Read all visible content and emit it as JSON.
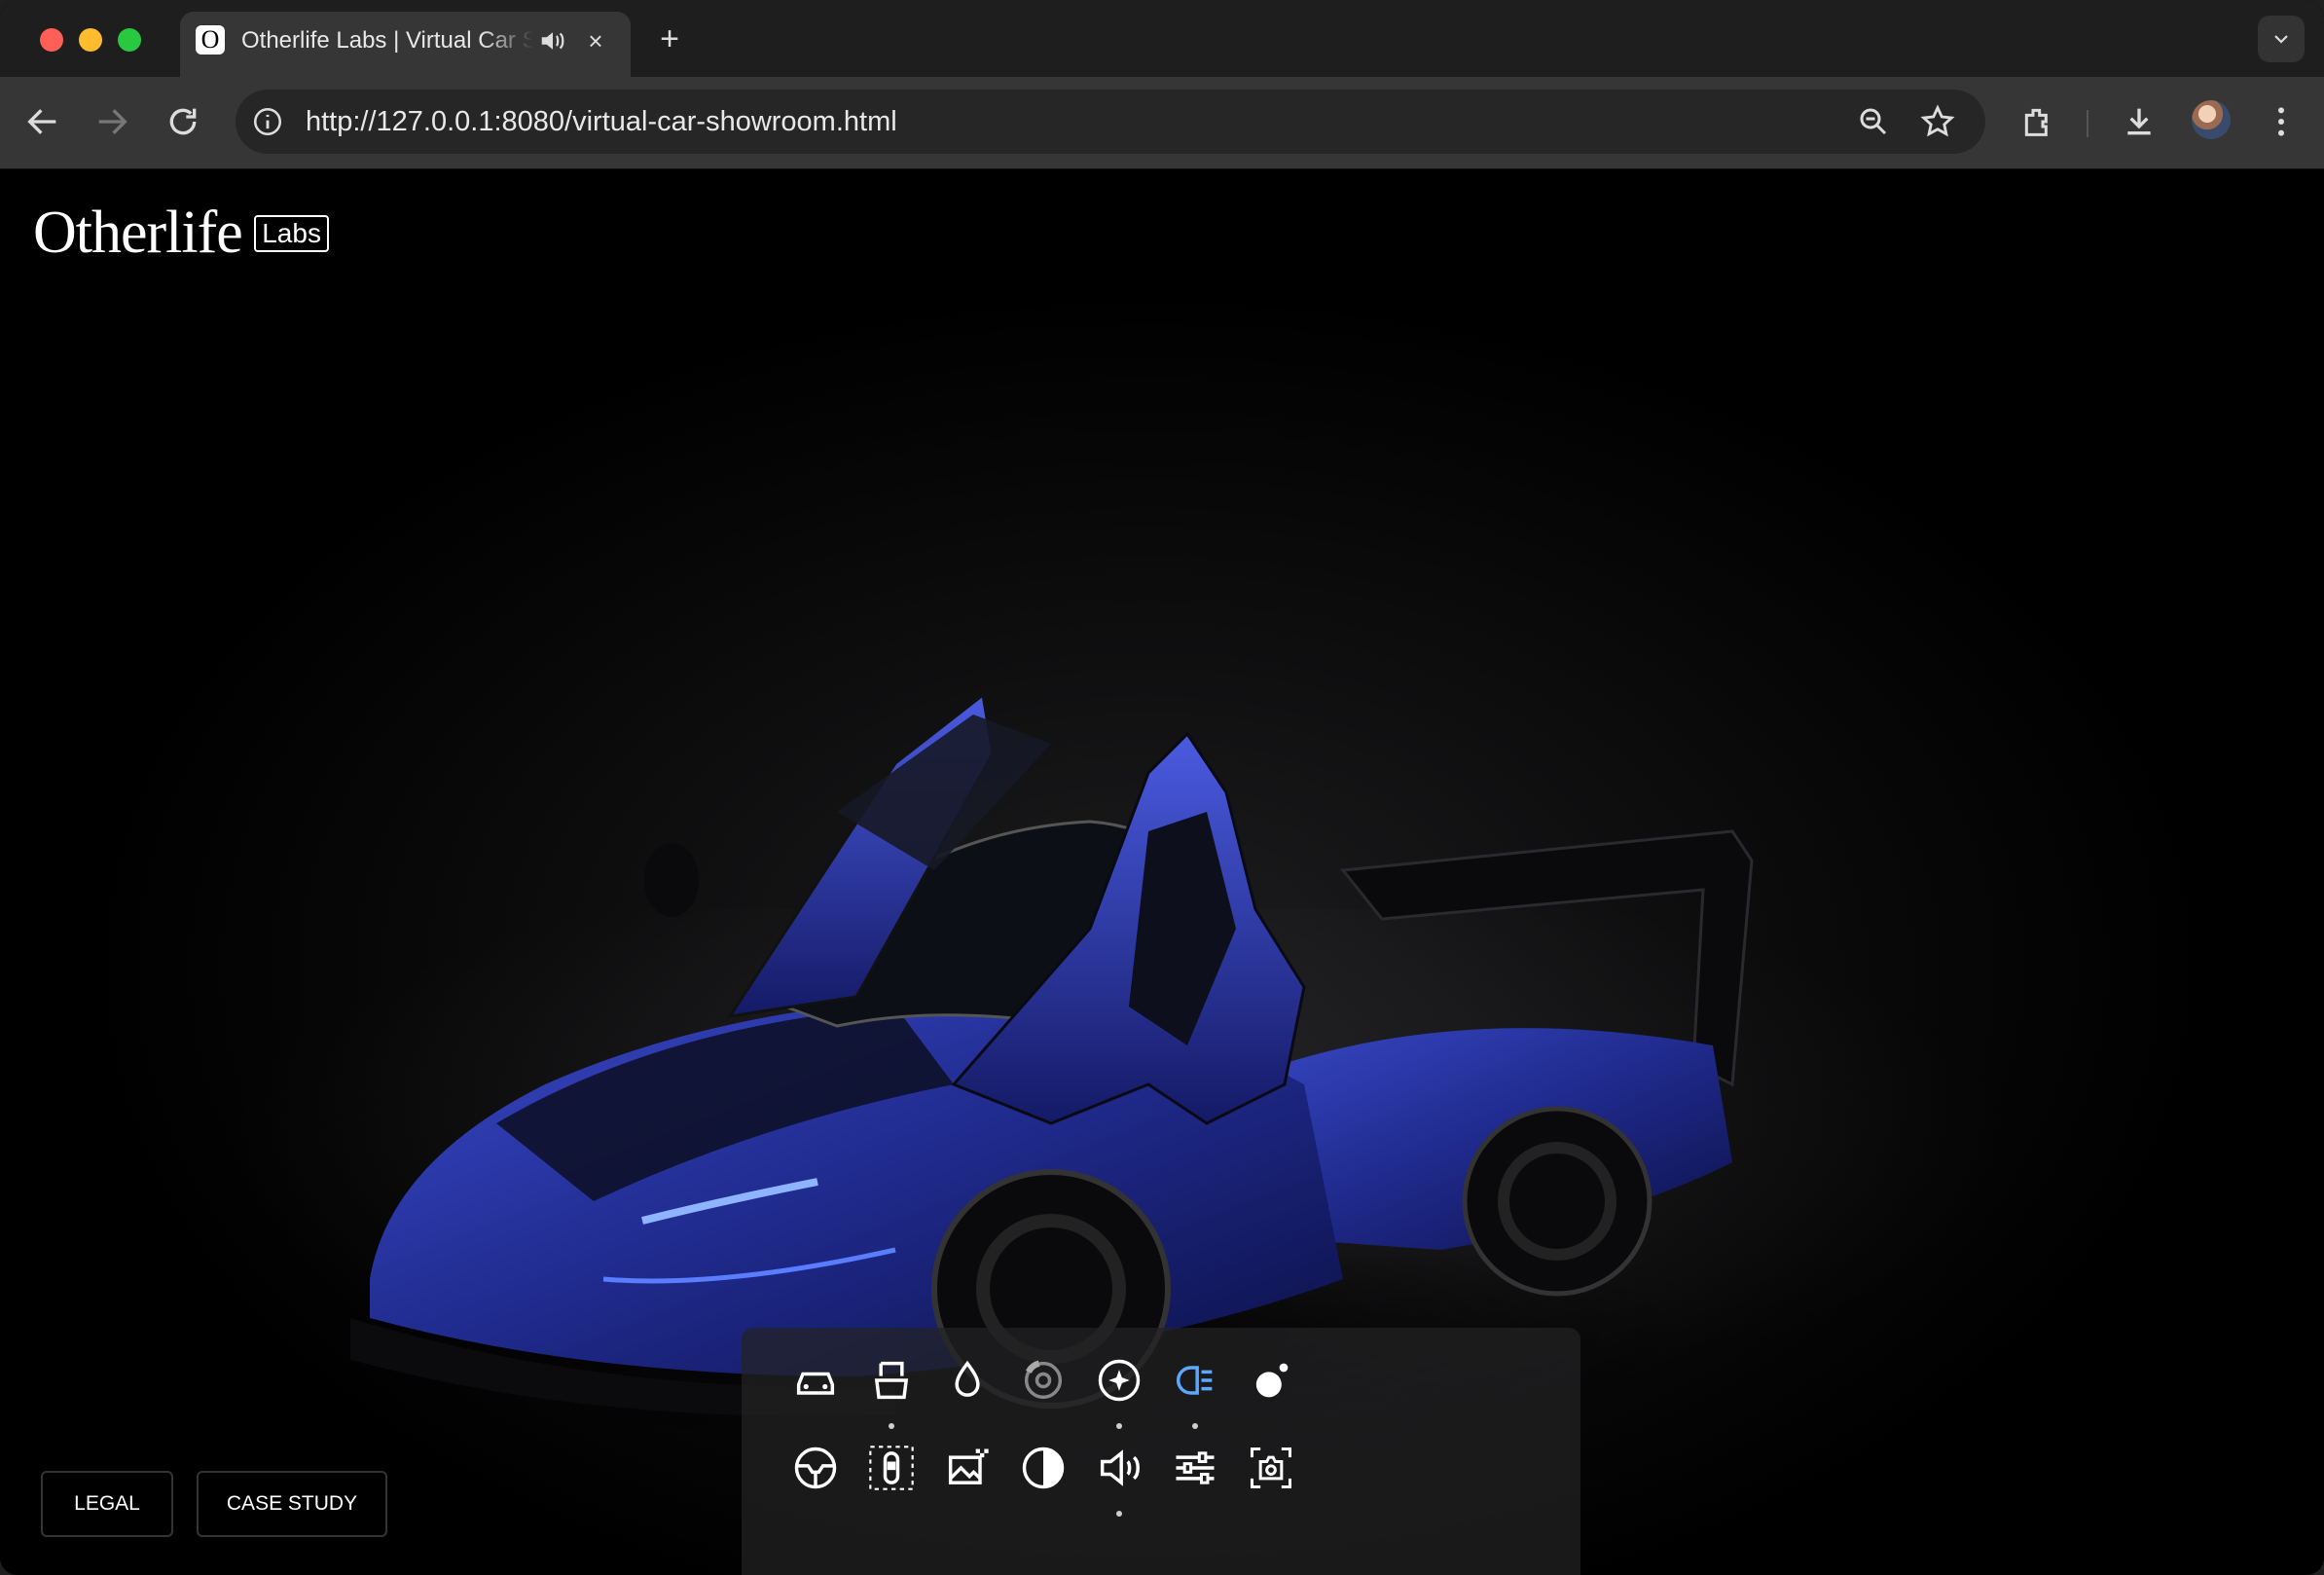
{
  "browser": {
    "tab_title": "Otherlife Labs | Virtual Car Showroom",
    "tab_favicon": "O",
    "url": "http://127.0.0.1:8080/virtual-car-showroom.html",
    "new_tab_symbol": "+",
    "close_symbol": "×",
    "colors": {
      "tabbar": "#1e1e1e",
      "toolbar": "#363636",
      "omnibox": "#262626"
    }
  },
  "page": {
    "brand_name": "Otherlife",
    "brand_tag": "Labs",
    "footer": {
      "legal_label": "LEGAL",
      "case_study_label": "CASE STUDY"
    },
    "car": {
      "paint_color": "#1f2a8c",
      "scene": "hypercar-with-open-butterfly-doors"
    },
    "controls_row1": [
      "car-view-icon",
      "door-open-icon",
      "paint-drop-icon",
      "brake-disc-icon",
      "sparkle-icon",
      "headlights-icon",
      "light-orb-icon"
    ],
    "controls_row2": [
      "steering-wheel-icon",
      "top-view-icon",
      "environment-icon",
      "contrast-icon",
      "sound-icon",
      "adjust-sliders-icon",
      "camera-icon"
    ],
    "active_control": "headlights",
    "accent_color": "#5aa8ff"
  }
}
